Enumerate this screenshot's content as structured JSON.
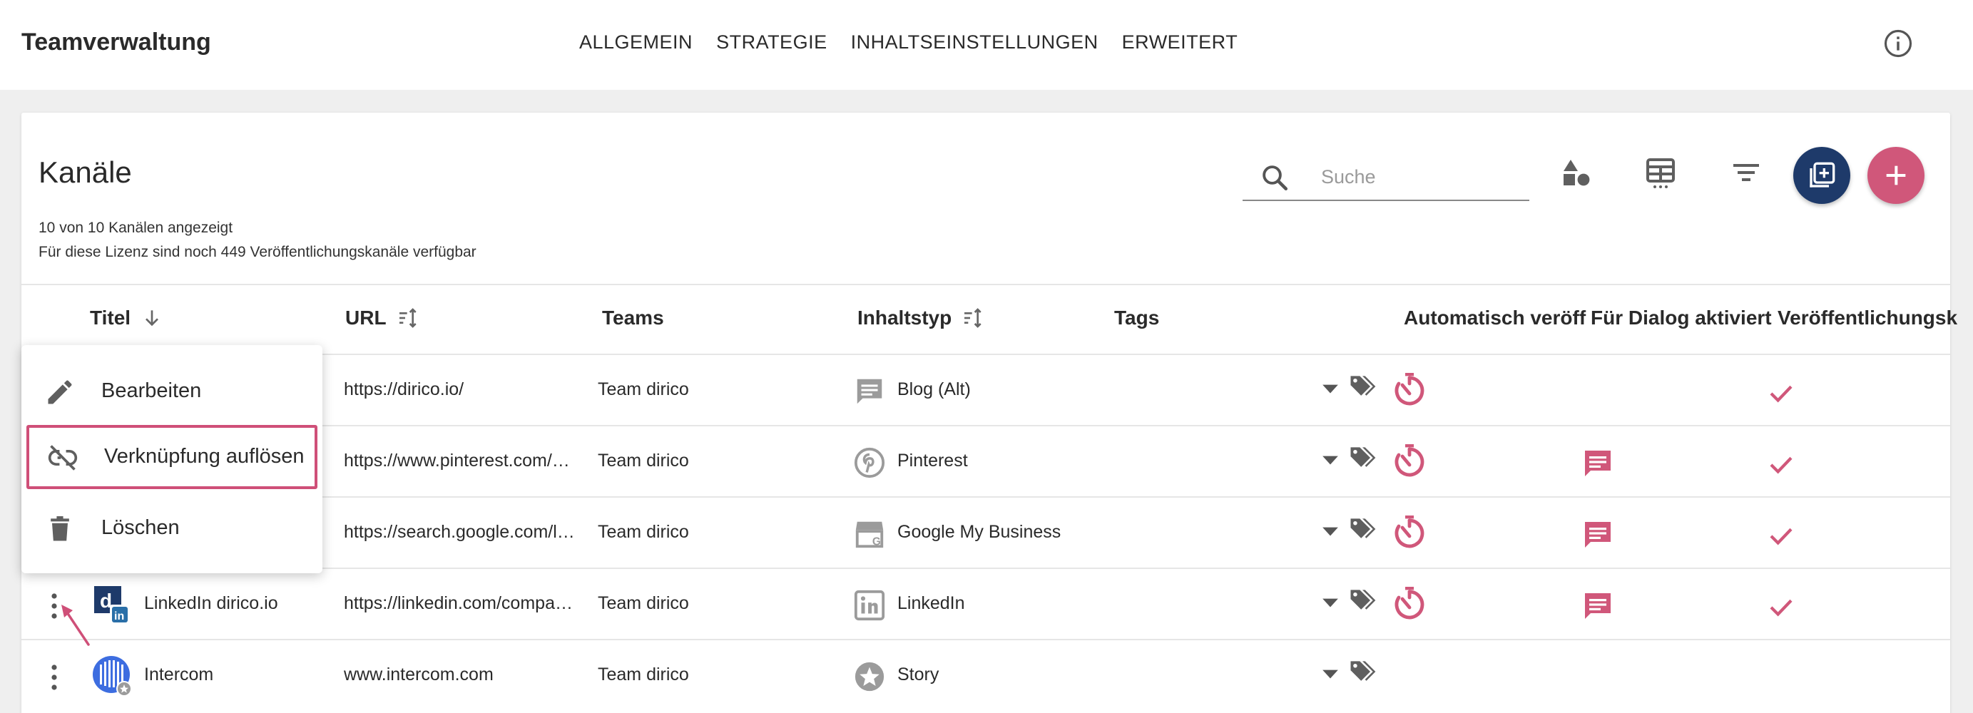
{
  "app": {
    "title": "Teamverwaltung"
  },
  "nav": [
    {
      "label": "ALLGEMEIN"
    },
    {
      "label": "STRATEGIE"
    },
    {
      "label": "INHALTSEINSTELLUNGEN"
    },
    {
      "label": "ERWEITERT"
    }
  ],
  "card": {
    "title": "Kanäle",
    "shown_text": "10 von 10 Kanälen angezeigt",
    "license_text": "Für diese Lizenz sind noch 449 Veröffentlichungskanäle verfügbar",
    "search_placeholder": "Suche"
  },
  "columns": {
    "title": "Titel",
    "url": "URL",
    "teams": "Teams",
    "content_type": "Inhaltstyp",
    "tags": "Tags",
    "auto_publish": "Automatisch veröff",
    "dialog": "Für Dialog aktiviert",
    "publish": "Veröffentlichungsk"
  },
  "rows": [
    {
      "title": "",
      "url": "https://dirico.io/",
      "team": "Team dirico",
      "content_type": "Blog (Alt)",
      "ctype_icon": "message-square-icon",
      "auto": true,
      "dialog": false,
      "publish": true
    },
    {
      "title": "",
      "url": "https://www.pinterest.com/dirico",
      "team": "Team dirico",
      "content_type": "Pinterest",
      "ctype_icon": "pinterest-icon",
      "auto": true,
      "dialog": true,
      "publish": true
    },
    {
      "title": "",
      "url": "https://search.google.com/local",
      "team": "Team dirico",
      "content_type": "Google My Business",
      "ctype_icon": "storefront-icon",
      "auto": true,
      "dialog": true,
      "publish": true
    },
    {
      "title": "LinkedIn dirico.io",
      "url": "https://linkedin.com/company/dirico",
      "team": "Team dirico",
      "content_type": "LinkedIn",
      "ctype_icon": "linkedin-icon",
      "auto": true,
      "dialog": true,
      "publish": true
    },
    {
      "title": "Intercom",
      "url": "www.intercom.com",
      "team": "Team dirico",
      "content_type": "Story",
      "ctype_icon": "star-icon",
      "auto": false,
      "dialog": false,
      "publish": false
    }
  ],
  "menu": [
    {
      "label": "Bearbeiten",
      "icon": "pencil-icon"
    },
    {
      "label": "Verknüpfung auflösen",
      "icon": "link-off-icon"
    },
    {
      "label": "Löschen",
      "icon": "trash-icon"
    }
  ],
  "colors": {
    "accent": "#d0577a",
    "navy": "#1e3a6a",
    "icon_gray": "#5f5f5f"
  }
}
